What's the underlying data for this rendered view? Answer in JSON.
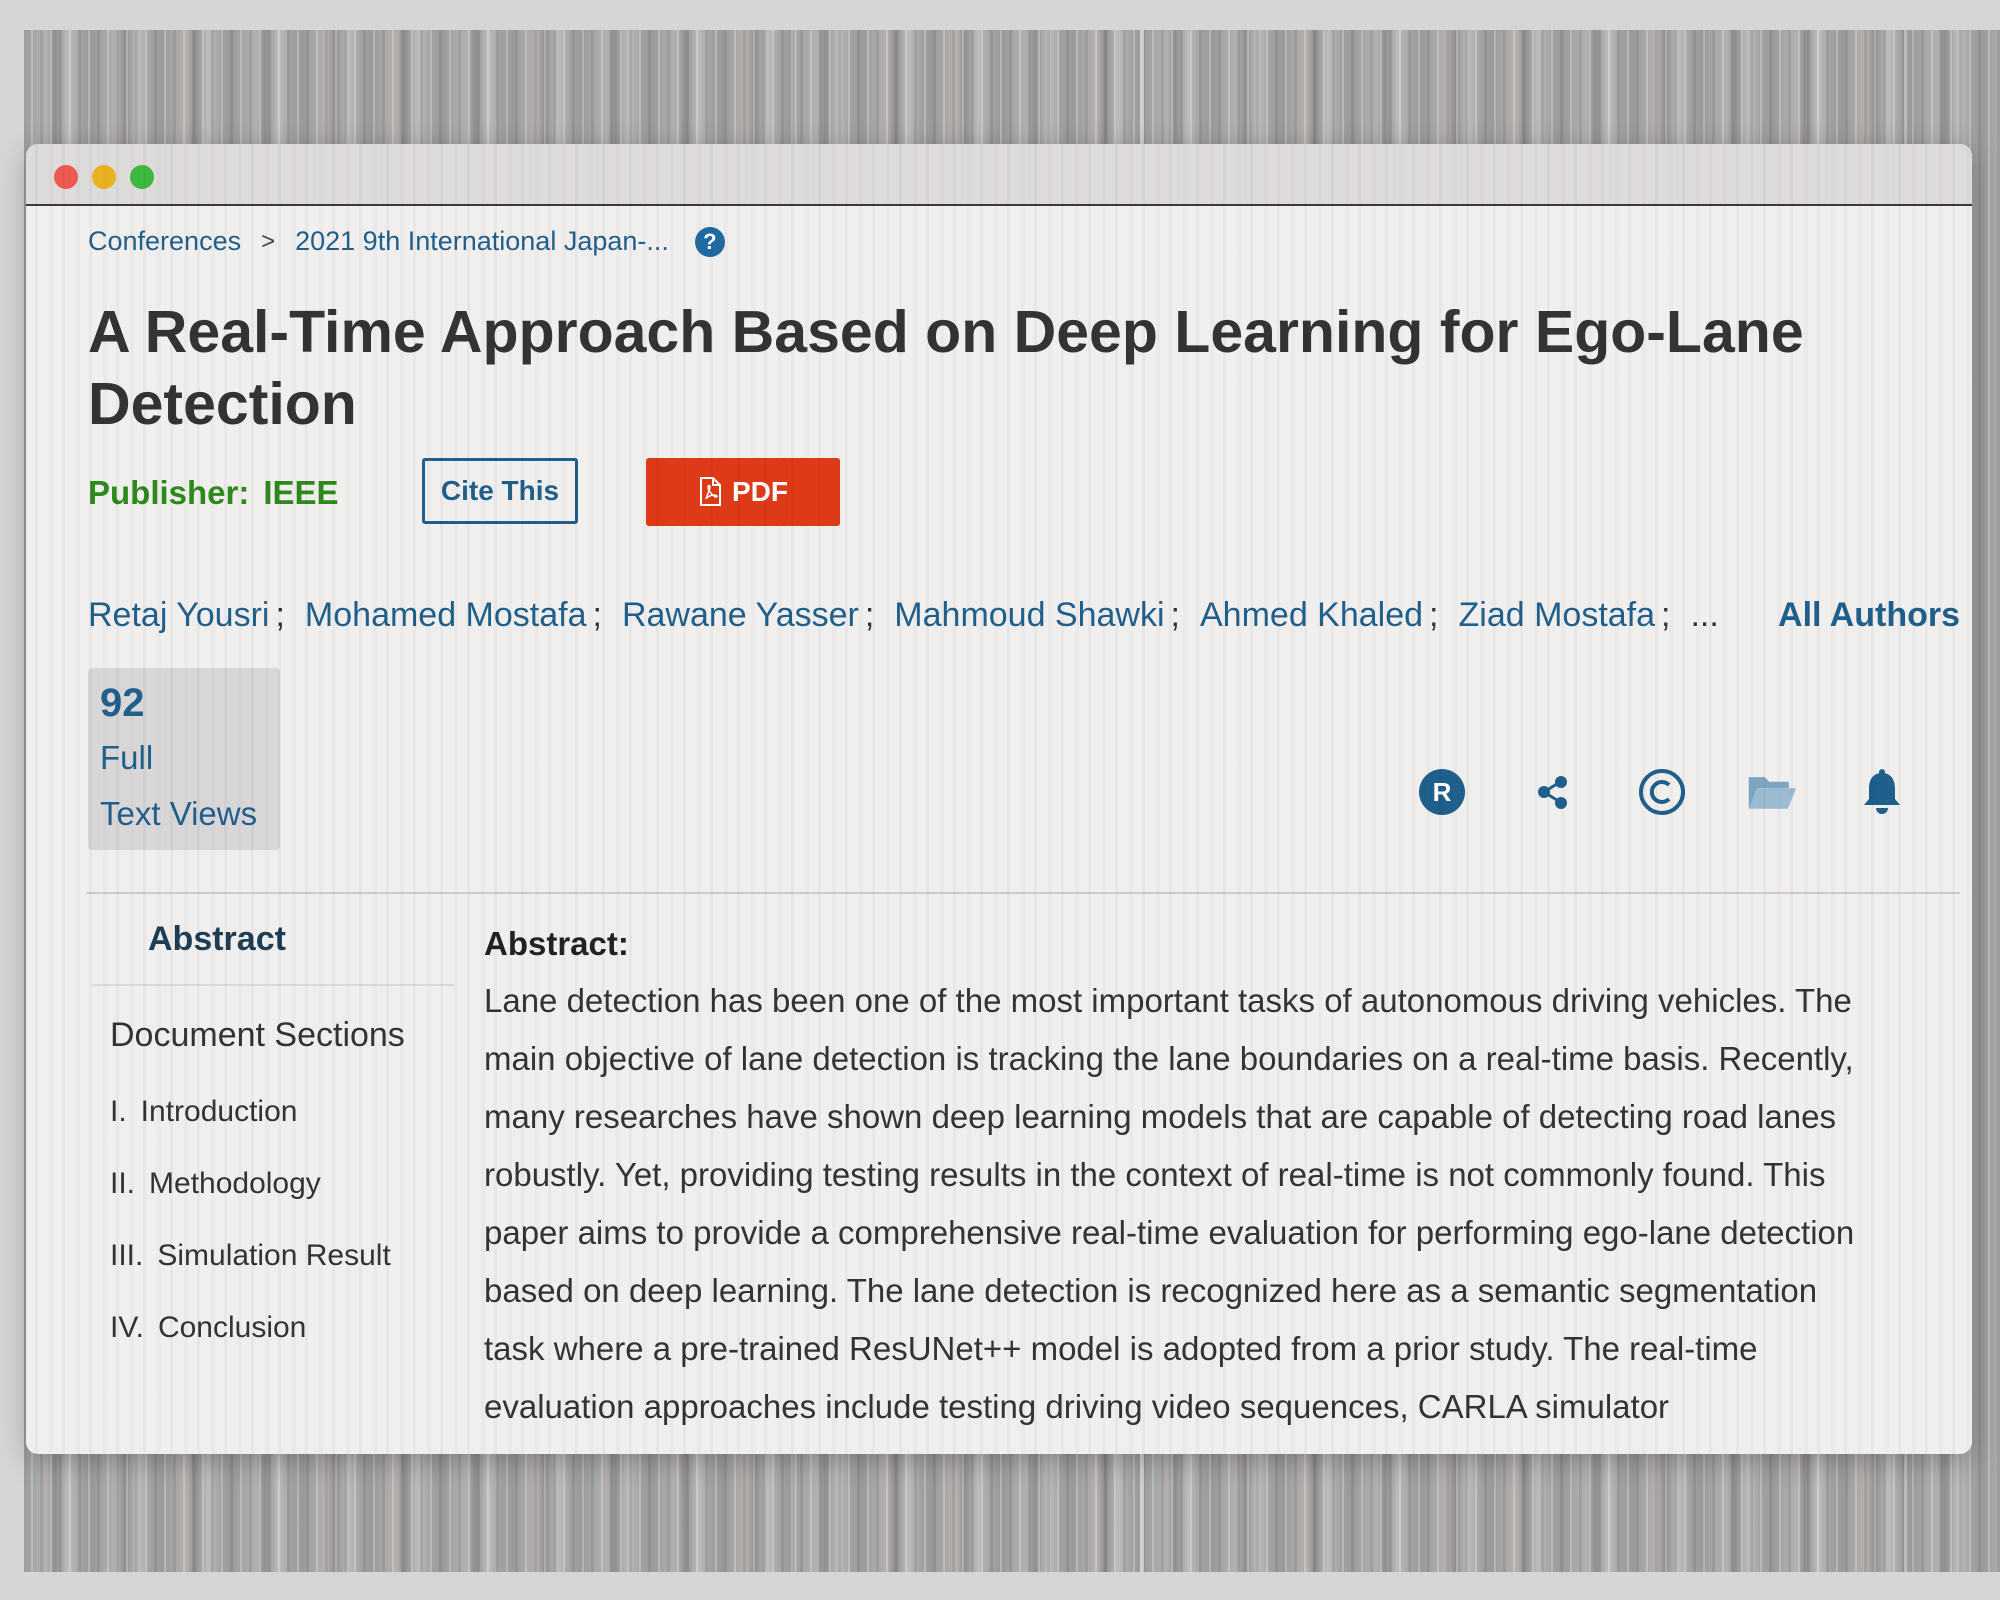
{
  "breadcrumb": {
    "items": [
      "Conferences",
      "2021 9th International Japan-..."
    ],
    "separator": ">",
    "help_icon": "question-circle-icon"
  },
  "paper": {
    "title": "A Real-Time Approach Based on Deep Learning for Ego-Lane Detection",
    "publisher_label": "Publisher:",
    "publisher_name": "IEEE",
    "cite_label": "Cite This",
    "pdf_label": "PDF"
  },
  "authors": {
    "list": [
      "Retaj Yousri",
      "Mohamed Mostafa",
      "Rawane Yasser",
      "Mahmoud Shawki",
      "Ahmed Khaled",
      "Ziad Mostafa"
    ],
    "separator": ";",
    "ellipsis": "...",
    "all_authors_label": "All Authors"
  },
  "metrics": {
    "count": "92",
    "label_line1": "Full",
    "label_line2": "Text Views"
  },
  "actions": [
    {
      "icon": "rights-permissions-icon",
      "label": "R"
    },
    {
      "icon": "share-icon"
    },
    {
      "icon": "copyright-icon"
    },
    {
      "icon": "folder-icon"
    },
    {
      "icon": "bell-icon"
    }
  ],
  "sidebar": {
    "abstract_tab": "Abstract",
    "sections_title": "Document Sections",
    "sections": [
      {
        "num": "I.",
        "label": "Introduction"
      },
      {
        "num": "II.",
        "label": "Methodology"
      },
      {
        "num": "III.",
        "label": "Simulation Result"
      },
      {
        "num": "IV.",
        "label": "Conclusion"
      }
    ]
  },
  "abstract": {
    "heading": "Abstract:",
    "lines": [
      "Lane detection has been one of the most important tasks of autonomous driving vehicles. The",
      "main objective of lane detection is tracking the lane boundaries on a real-time basis. Recently,",
      "many researches have shown deep learning models that are capable of detecting road lanes",
      "robustly. Yet, providing testing results in the context of real-time is not commonly found. This",
      "paper aims to provide a comprehensive real-time evaluation for performing ego-lane detection",
      "based on deep learning. The lane detection is recognized here as a semantic segmentation",
      "task where a pre-trained ResUNet++ model is adopted from a prior study. The real-time",
      "evaluation approaches include testing driving video sequences, CARLA simulator"
    ]
  },
  "colors": {
    "link": "#1f5f8b",
    "publisher": "#2c8a1a",
    "pdf": "#de3a17",
    "title": "#333333"
  }
}
